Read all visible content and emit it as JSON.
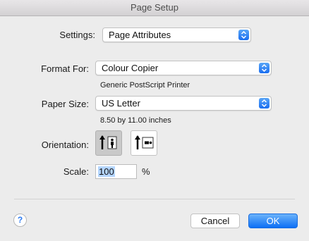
{
  "window": {
    "title": "Page Setup"
  },
  "settings": {
    "label": "Settings:",
    "value": "Page Attributes"
  },
  "format_for": {
    "label": "Format For:",
    "value": "Colour Copier",
    "description": "Generic PostScript Printer"
  },
  "paper_size": {
    "label": "Paper Size:",
    "value": "US Letter",
    "description": "8.50 by 11.00 inches"
  },
  "orientation": {
    "label": "Orientation:",
    "options": [
      "portrait",
      "landscape"
    ],
    "selected": "portrait"
  },
  "scale": {
    "label": "Scale:",
    "value": "100",
    "unit": "%"
  },
  "footer": {
    "help_label": "?",
    "cancel_label": "Cancel",
    "ok_label": "OK"
  },
  "colors": {
    "accent": "#1a6ef0",
    "background": "#ececec",
    "selection": "#b4d5fe"
  }
}
